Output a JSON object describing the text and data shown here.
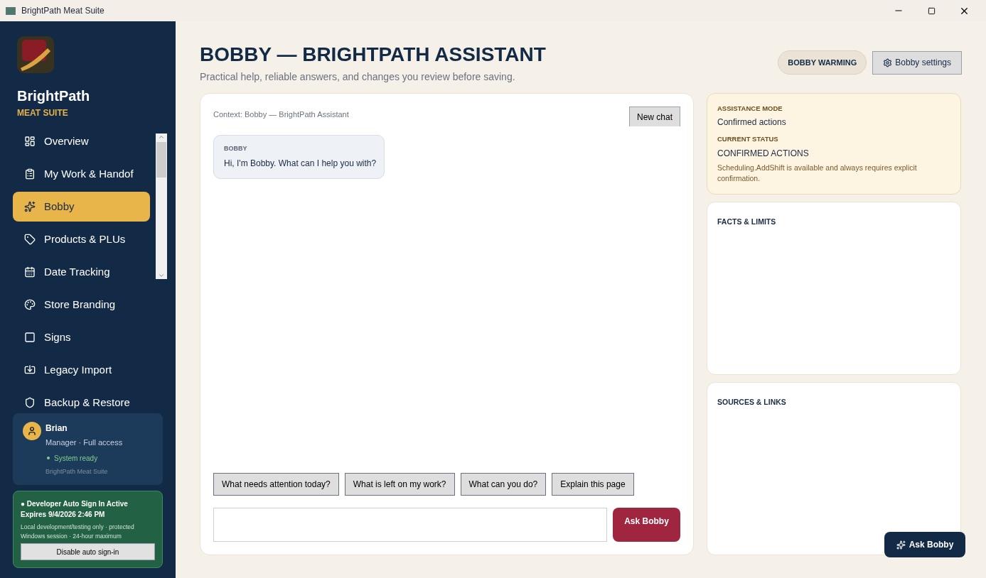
{
  "window": {
    "title": "BrightPath Meat Suite"
  },
  "sidebar": {
    "brand": "BrightPath",
    "subtitle": "MEAT SUITE",
    "items": [
      {
        "label": "Overview",
        "selected": false
      },
      {
        "label": "My Work & Handof",
        "selected": false
      },
      {
        "label": "Bobby",
        "selected": true
      },
      {
        "label": "Products & PLUs",
        "selected": false
      },
      {
        "label": "Date Tracking",
        "selected": false
      },
      {
        "label": "Store Branding",
        "selected": false
      },
      {
        "label": "Signs",
        "selected": false
      },
      {
        "label": "Legacy Import",
        "selected": false
      },
      {
        "label": "Backup & Restore",
        "selected": false
      }
    ],
    "user": {
      "name": "Brian",
      "role": "Manager · Full access",
      "status": "System ready",
      "app": "BrightPath Meat Suite"
    },
    "dev_notice": {
      "title": "● Developer Auto Sign In Active",
      "expires": "Expires 9/4/2026 2:46 PM",
      "note": "Local development/testing only · protected Windows session · 24-hour maximum",
      "button": "Disable auto sign-in"
    }
  },
  "header": {
    "title": "BOBBY — BRIGHTPATH ASSISTANT",
    "subtitle": "Practical help, reliable answers, and changes you review before saving.",
    "badge": "BOBBY WARMING",
    "settings_button": "Bobby settings"
  },
  "chat": {
    "context": "Context: Bobby — BrightPath Assistant",
    "new_chat": "New chat",
    "messages": [
      {
        "sender": "BOBBY",
        "text": "Hi, I'm Bobby. What can I help you with?"
      }
    ],
    "suggestions": [
      "What needs attention today?",
      "What is left on my work?",
      "What can you do?",
      "Explain this page"
    ],
    "send_button": "Ask Bobby"
  },
  "assistance": {
    "mode_label": "ASSISTANCE MODE",
    "mode": "Confirmed actions",
    "status_label": "CURRENT STATUS",
    "status": "CONFIRMED ACTIONS",
    "note": "Scheduling.AddShift is available and always requires explicit confirmation."
  },
  "facts": {
    "title": "FACTS & LIMITS"
  },
  "sources": {
    "title": "SOURCES & LINKS"
  },
  "floating_button": "Ask Bobby"
}
